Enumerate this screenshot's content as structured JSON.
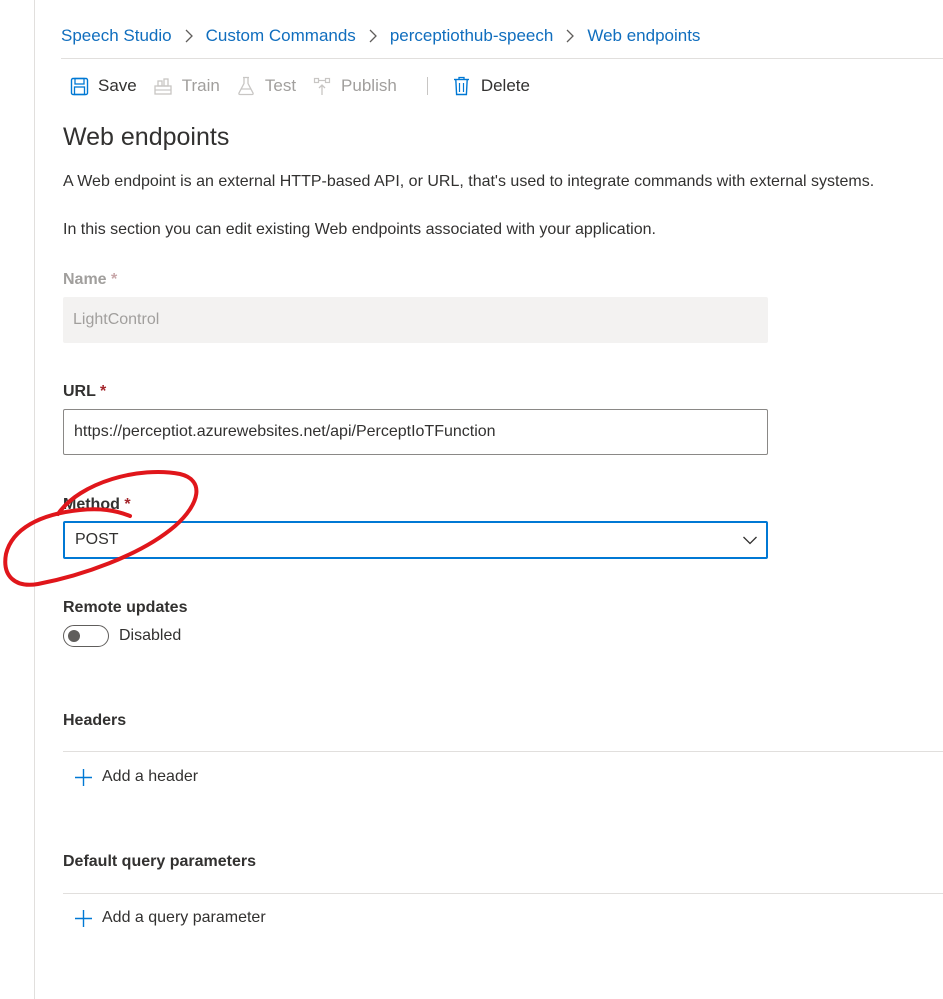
{
  "breadcrumb": {
    "items": [
      "Speech Studio",
      "Custom Commands",
      "perceptiothub-speech",
      "Web endpoints"
    ]
  },
  "toolbar": {
    "save_label": "Save",
    "train_label": "Train",
    "test_label": "Test",
    "publish_label": "Publish",
    "delete_label": "Delete"
  },
  "page": {
    "title": "Web endpoints",
    "description1": "A Web endpoint is an external HTTP-based API, or URL, that's used to integrate commands with external systems.",
    "description2": "In this section you can edit existing Web endpoints associated with your application."
  },
  "form": {
    "name_label": "Name",
    "name_value": "LightControl",
    "url_label": "URL",
    "url_value": "https://perceptiot.azurewebsites.net/api/PerceptIoTFunction",
    "method_label": "Method",
    "method_value": "POST",
    "required_marker": "*",
    "remote_updates_label": "Remote updates",
    "remote_updates_state": "Disabled"
  },
  "headers": {
    "title": "Headers",
    "add_label": "Add a header"
  },
  "query_params": {
    "title": "Default query parameters",
    "add_label": "Add a query parameter"
  },
  "colors": {
    "accent": "#0078d4",
    "link": "#106ebe",
    "annotation": "#e0161b",
    "required": "#a4262c"
  },
  "icons": [
    "chevron-right-icon",
    "save-icon",
    "train-icon",
    "test-icon",
    "publish-icon",
    "delete-icon",
    "chevron-down-icon",
    "plus-icon"
  ]
}
